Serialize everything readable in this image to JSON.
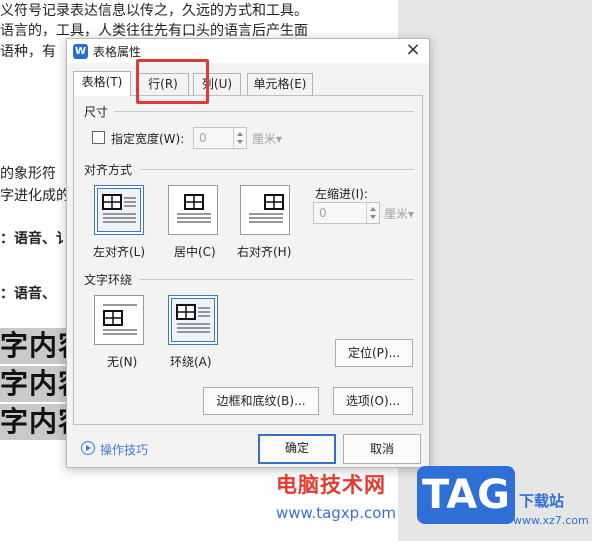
{
  "document": {
    "lines": [
      "义符号记录表达信息以传之，久远的方式和工具。",
      "语言的，工具，人类往往先有口头的语言后产生面",
      "语种，有"
    ],
    "mid_lines": [
      "的象形符",
      "字进化成的"
    ],
    "bold_labels": [
      "：语音、讠",
      "：语音、"
    ],
    "big_text": [
      "字内容",
      "字内容",
      "字内容"
    ]
  },
  "dialog": {
    "title": "表格属性",
    "app_icon_letter": "W",
    "close_symbol": "×",
    "tabs": [
      {
        "label": "表格(T)",
        "active": true
      },
      {
        "label": "行(R)",
        "active": false
      },
      {
        "label": "列(U)",
        "active": false
      },
      {
        "label": "单元格(E)",
        "active": false
      }
    ],
    "size": {
      "section_title": "尺寸",
      "specify_width_label": "指定宽度(W):",
      "specify_width_checked": false,
      "width_value": "0",
      "width_unit": "厘米▾"
    },
    "alignment": {
      "section_title": "对齐方式",
      "options": [
        {
          "label": "左对齐(L)",
          "selected": true
        },
        {
          "label": "居中(C)",
          "selected": false
        },
        {
          "label": "右对齐(H)",
          "selected": false
        }
      ],
      "indent_label": "左缩进(I):",
      "indent_value": "0",
      "indent_unit": "厘米▾"
    },
    "wrap": {
      "section_title": "文字环绕",
      "options": [
        {
          "label": "无(N)",
          "selected": false
        },
        {
          "label": "环绕(A)",
          "selected": true
        }
      ],
      "position_button": "定位(P)..."
    },
    "borders_button": "边框和底纹(B)...",
    "options_button": "选项(O)...",
    "tips_link": "操作技巧",
    "ok_button": "确定",
    "cancel_button": "取消",
    "highlight_color": "#e03a3a"
  },
  "watermark": {
    "site_name": "电脑技术网",
    "site_url": "www.tagxp.com",
    "logo": "TAG",
    "logo_caption": "下载站",
    "logo_url": "www.xz7.com"
  }
}
